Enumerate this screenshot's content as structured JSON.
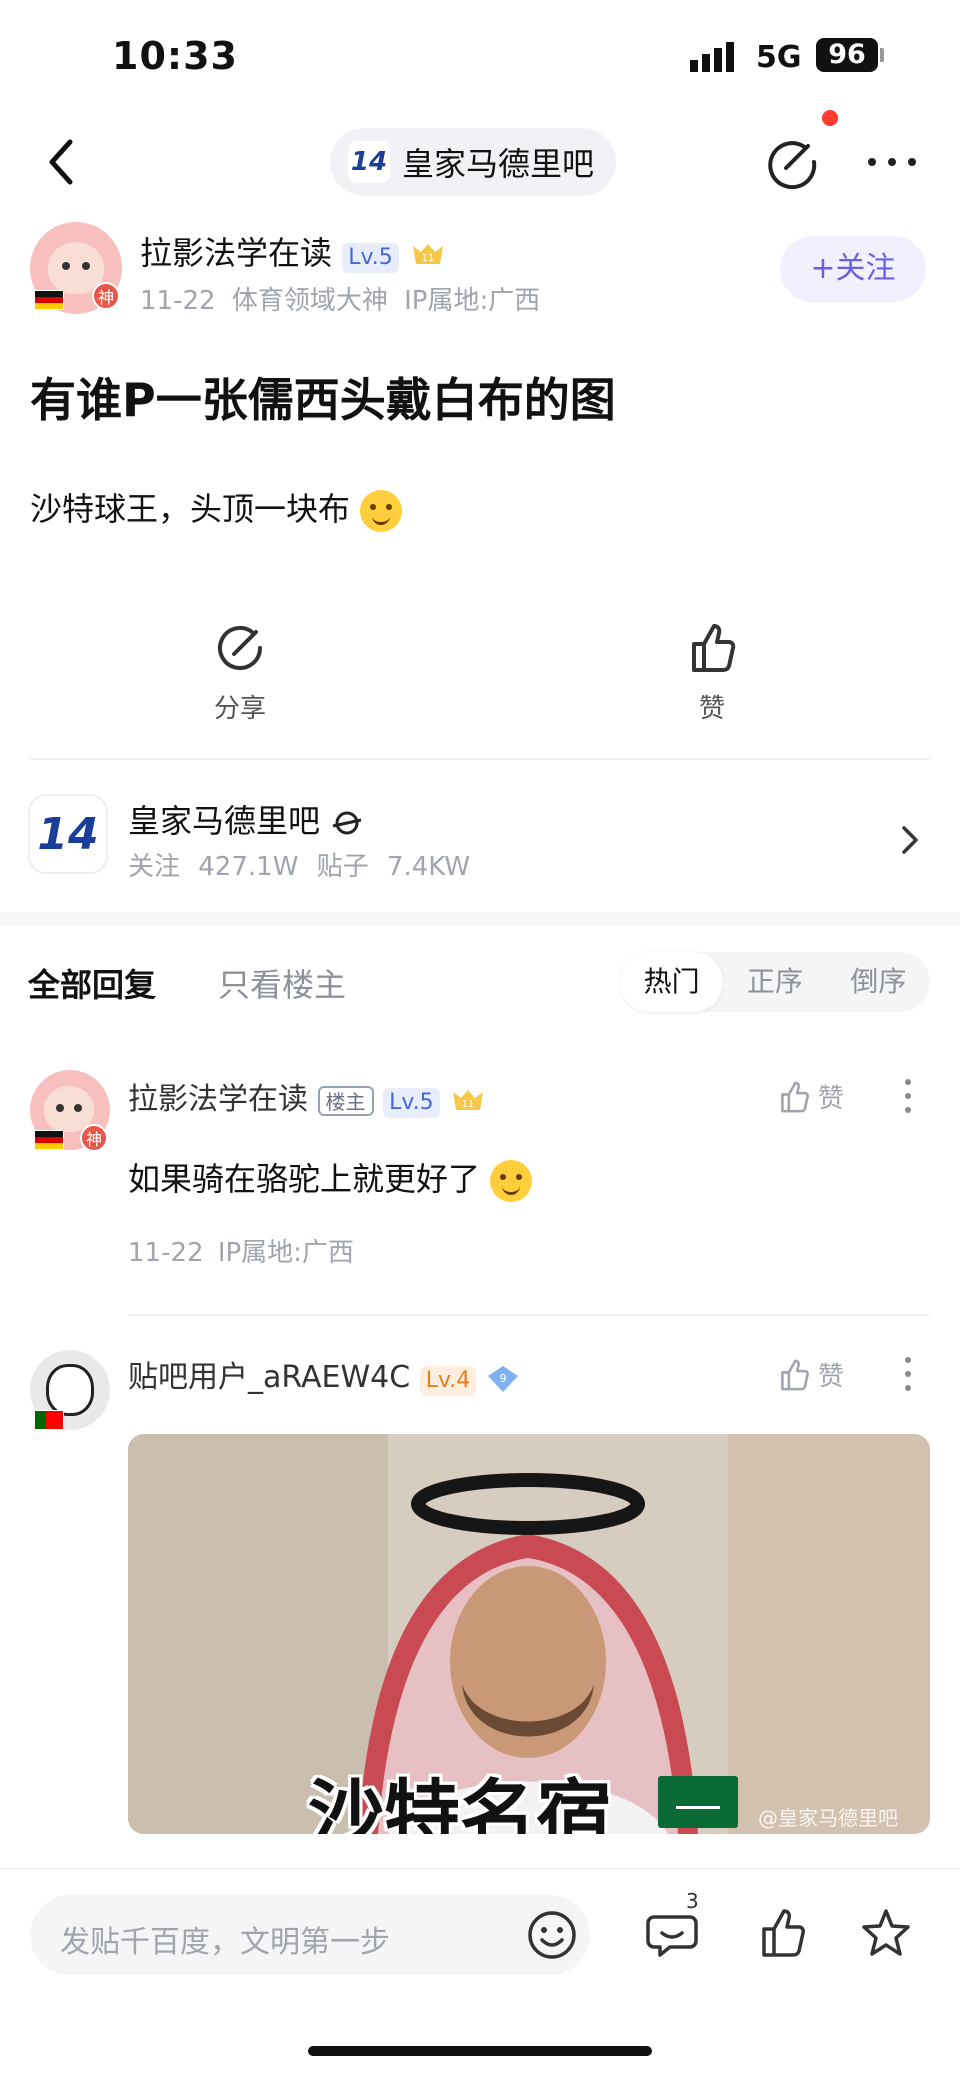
{
  "status_bar": {
    "time": "10:33",
    "network": "5G",
    "battery": "96"
  },
  "nav": {
    "forum_badge": "14",
    "forum_name": "皇家马德里吧"
  },
  "author": {
    "name": "拉影法学在读",
    "level": "Lv.5",
    "badge_number": "11",
    "avatar_badge": "神",
    "date": "11-22",
    "honor": "体育领域大神",
    "ip": "IP属地:广西",
    "follow_label": "+关注"
  },
  "post": {
    "title": "有谁P一张儒西头戴白布的图",
    "body": "沙特球王，头顶一块布"
  },
  "actions": {
    "share": "分享",
    "like": "赞"
  },
  "forum_card": {
    "logo": "14",
    "name": "皇家马德里吧",
    "followers": "关注 427.1W",
    "posts": "贴子 7.4KW"
  },
  "tabs": {
    "all": "全部回复",
    "host_only": "只看楼主",
    "sort": [
      "热门",
      "正序",
      "倒序"
    ],
    "active_sort": "热门"
  },
  "replies": [
    {
      "name": "拉影法学在读",
      "host_tag": "楼主",
      "level": "Lv.5",
      "badge_number": "11",
      "avatar_badge": "神",
      "like_label": "赞",
      "text": "如果骑在骆驼上就更好了",
      "date": "11-22",
      "ip": "IP属地:广西"
    },
    {
      "name": "贴吧用户_aRAEW4C",
      "level": "Lv.4",
      "badge_number": "9",
      "like_label": "赞",
      "image_caption": "沙特名宿",
      "image_watermark": "@皇家马德里吧"
    }
  ],
  "bottom_bar": {
    "placeholder": "发贴千百度，文明第一步",
    "comment_count": "3"
  },
  "colors": {
    "accent": "#6e5de6",
    "level_blue": "#4468d6",
    "level_orange": "#e0801e",
    "red_badge": "#e8574a"
  }
}
